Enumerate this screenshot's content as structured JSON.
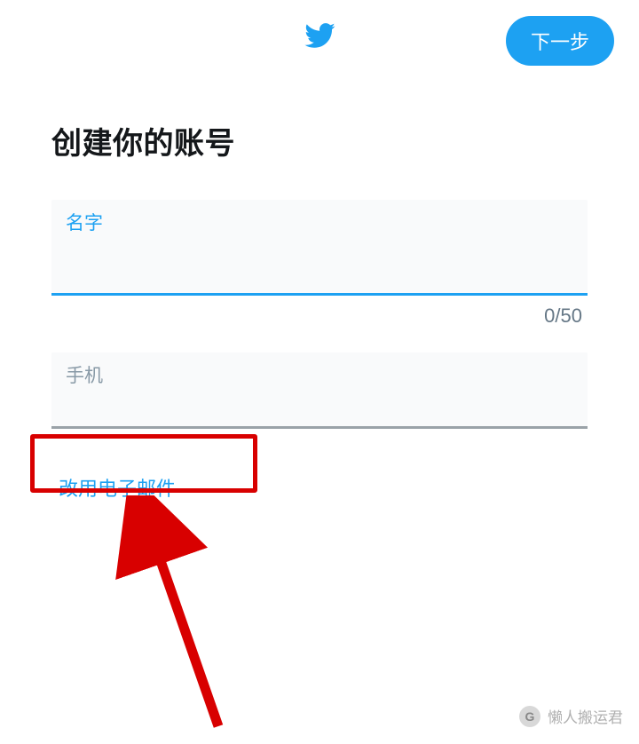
{
  "header": {
    "next_button_label": "下一步"
  },
  "page_title": "创建你的账号",
  "name_field": {
    "label": "名字",
    "value": "",
    "counter": "0/50"
  },
  "phone_field": {
    "label": "手机",
    "value": ""
  },
  "switch_link_label": "改用电子邮件",
  "watermark": {
    "icon_text": "G",
    "text": "懒人搬运君"
  }
}
